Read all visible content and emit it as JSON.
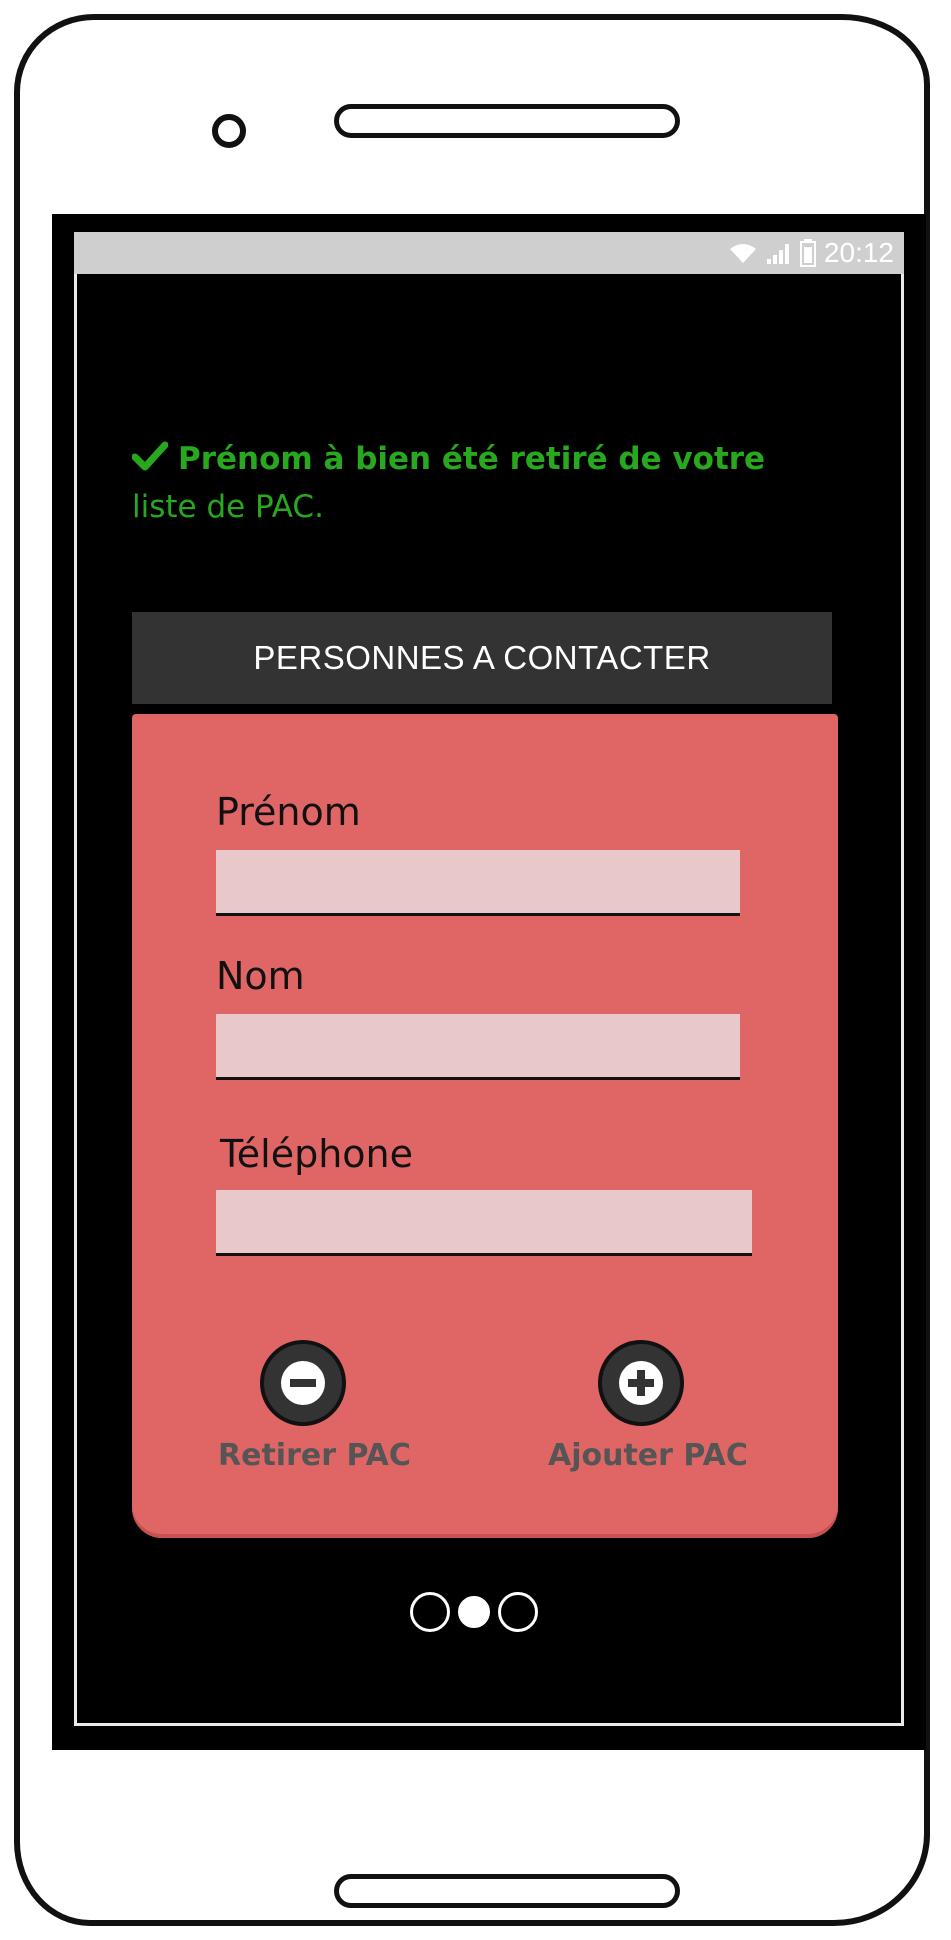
{
  "status_bar": {
    "time": "20:12",
    "icons": [
      "wifi-icon",
      "signal-icon",
      "battery-icon"
    ]
  },
  "notification": {
    "icon": "checkmark-icon",
    "line1": "Prénom à bien été retiré de votre",
    "line2": "liste de PAC.",
    "color": "#27a81f"
  },
  "pac": {
    "header": "PERSONNES A CONTACTER",
    "fields": [
      {
        "label": "Prénom",
        "value": ""
      },
      {
        "label": "Nom",
        "value": ""
      },
      {
        "label": "Téléphone",
        "value": ""
      }
    ],
    "remove_label": "Retirer PAC",
    "add_label": "Ajouter PAC"
  },
  "pager": {
    "pages": 3,
    "active": 2
  },
  "colors": {
    "panel": "#e06666",
    "header": "#333333",
    "input": "#e8c8c8"
  }
}
